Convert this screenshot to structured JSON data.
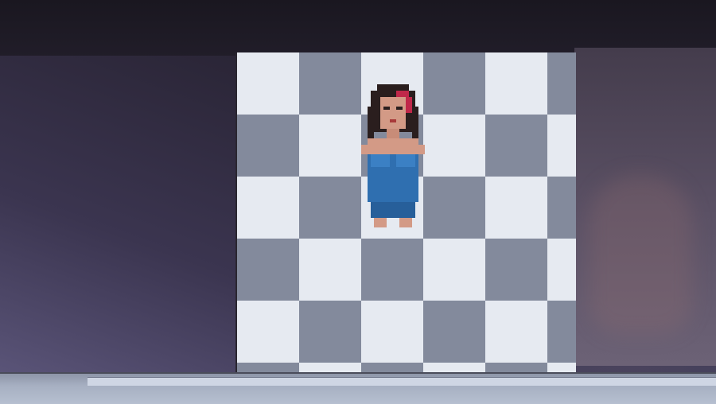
{
  "colors": {
    "checker_light": "#e7ebf2",
    "checker_dark": "#7f8698",
    "sprite_dress": "#2f6fb0",
    "sprite_hair": "#2a1e1e",
    "sprite_skin": "#d39a86",
    "sprite_accent": "#c0284a"
  },
  "sprite": {
    "name": "pixel character",
    "icons": [
      "character-sprite"
    ]
  }
}
